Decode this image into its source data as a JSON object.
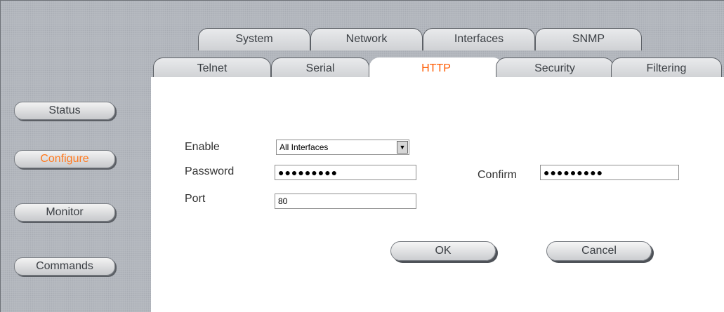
{
  "tabs_top": [
    {
      "label": "System",
      "active": false
    },
    {
      "label": "Network",
      "active": false
    },
    {
      "label": "Interfaces",
      "active": false
    },
    {
      "label": "SNMP",
      "active": false
    }
  ],
  "tabs_bottom": [
    {
      "label": "Telnet",
      "active": false
    },
    {
      "label": "Serial",
      "active": false
    },
    {
      "label": "HTTP",
      "active": true
    },
    {
      "label": "Security",
      "active": false
    },
    {
      "label": "Filtering",
      "active": false
    }
  ],
  "sidebar": [
    {
      "label": "Status",
      "active": false
    },
    {
      "label": "Configure",
      "active": true
    },
    {
      "label": "Monitor",
      "active": false
    },
    {
      "label": "Commands",
      "active": false
    }
  ],
  "form": {
    "enable_label": "Enable",
    "enable_value": "All Interfaces",
    "password_label": "Password",
    "password_value": "●●●●●●●●●",
    "confirm_label": "Confirm",
    "confirm_value": "●●●●●●●●●",
    "port_label": "Port",
    "port_value": "80"
  },
  "buttons": {
    "ok": "OK",
    "cancel": "Cancel"
  },
  "colors": {
    "active_text": "#ff5a00",
    "frame_bg": "#b9bdc3",
    "panel_bg": "#ffffff"
  }
}
